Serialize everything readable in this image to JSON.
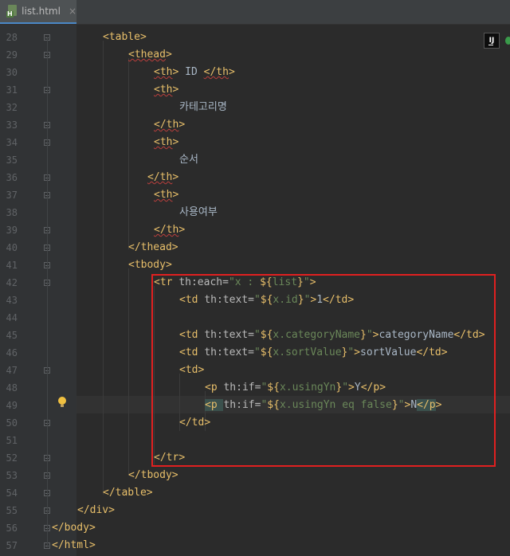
{
  "tabs": [
    {
      "label": "list.html",
      "close": "×",
      "badge": "H"
    }
  ],
  "ide_badge": "IJ",
  "lines": [
    {
      "num": "28",
      "tokens": [
        [
          "tag",
          "<table"
        ],
        [
          "tag",
          ">"
        ]
      ]
    },
    {
      "num": "29",
      "tokens": [
        [
          "tag",
          "<thead"
        ],
        [
          "tag",
          ">"
        ]
      ]
    },
    {
      "num": "30",
      "tokens": [
        [
          "tag",
          "<th"
        ],
        [
          "tag",
          ">"
        ],
        [
          "text",
          " ID "
        ],
        [
          "tag",
          "</th"
        ],
        [
          "tag",
          ">"
        ]
      ]
    },
    {
      "num": "31",
      "tokens": [
        [
          "tag",
          "<th"
        ],
        [
          "tag",
          ">"
        ]
      ]
    },
    {
      "num": "32",
      "tokens": [
        [
          "kr",
          "카테고리명"
        ]
      ]
    },
    {
      "num": "33",
      "tokens": [
        [
          "tag",
          "</th"
        ],
        [
          "tag",
          ">"
        ]
      ]
    },
    {
      "num": "34",
      "tokens": [
        [
          "tag",
          "<th"
        ],
        [
          "tag",
          ">"
        ]
      ]
    },
    {
      "num": "35",
      "tokens": [
        [
          "kr",
          "순서"
        ]
      ]
    },
    {
      "num": "36",
      "tokens": [
        [
          "tag",
          "</th"
        ],
        [
          "tag",
          ">"
        ]
      ]
    },
    {
      "num": "37",
      "tokens": [
        [
          "tag",
          "<th"
        ],
        [
          "tag",
          ">"
        ]
      ]
    },
    {
      "num": "38",
      "tokens": [
        [
          "kr",
          "사용여부"
        ]
      ]
    },
    {
      "num": "39",
      "tokens": [
        [
          "tag",
          "</th"
        ],
        [
          "tag",
          ">"
        ]
      ]
    },
    {
      "num": "40",
      "tokens": [
        [
          "tag",
          "</thead"
        ],
        [
          "tag",
          ">"
        ]
      ]
    },
    {
      "num": "41",
      "tokens": [
        [
          "tag",
          "<tbody"
        ],
        [
          "tag",
          ">"
        ]
      ]
    },
    {
      "num": "42",
      "tokens": [
        [
          "tag",
          "<tr "
        ],
        [
          "attr",
          "th:each="
        ],
        [
          "str",
          "\"x : "
        ],
        [
          "dollar",
          "${"
        ],
        [
          "str",
          "list"
        ],
        [
          "dollar",
          "}"
        ],
        [
          "str",
          "\""
        ],
        [
          "tag",
          ">"
        ]
      ]
    },
    {
      "num": "43",
      "tokens": [
        [
          "tag",
          "<td "
        ],
        [
          "attr",
          "th:text="
        ],
        [
          "str",
          "\""
        ],
        [
          "dollar",
          "${"
        ],
        [
          "str",
          "x.id"
        ],
        [
          "dollar",
          "}"
        ],
        [
          "str",
          "\""
        ],
        [
          "tag",
          ">"
        ],
        [
          "text",
          "1"
        ],
        [
          "tag",
          "</td"
        ],
        [
          "tag",
          ">"
        ]
      ]
    },
    {
      "num": "44",
      "tokens": []
    },
    {
      "num": "45",
      "tokens": [
        [
          "tag",
          "<td "
        ],
        [
          "attr",
          "th:text="
        ],
        [
          "str",
          "\""
        ],
        [
          "dollar",
          "${"
        ],
        [
          "str",
          "x.categoryName"
        ],
        [
          "dollar",
          "}"
        ],
        [
          "str",
          "\""
        ],
        [
          "tag",
          ">"
        ],
        [
          "text",
          "categoryName"
        ],
        [
          "tag",
          "</td"
        ],
        [
          "tag",
          ">"
        ]
      ]
    },
    {
      "num": "46",
      "tokens": [
        [
          "tag",
          "<td "
        ],
        [
          "attr",
          "th:text="
        ],
        [
          "str",
          "\""
        ],
        [
          "dollar",
          "${"
        ],
        [
          "str",
          "x.sortValue"
        ],
        [
          "dollar",
          "}"
        ],
        [
          "str",
          "\""
        ],
        [
          "tag",
          ">"
        ],
        [
          "text",
          "sortValue"
        ],
        [
          "tag",
          "</td"
        ],
        [
          "tag",
          ">"
        ]
      ]
    },
    {
      "num": "47",
      "tokens": [
        [
          "tag",
          "<td"
        ],
        [
          "tag",
          ">"
        ]
      ]
    },
    {
      "num": "48",
      "tokens": [
        [
          "tag",
          "<p "
        ],
        [
          "attr",
          "th:if="
        ],
        [
          "str",
          "\""
        ],
        [
          "dollar",
          "${"
        ],
        [
          "str",
          "x.usingYn"
        ],
        [
          "dollar",
          "}"
        ],
        [
          "str",
          "\""
        ],
        [
          "tag",
          ">"
        ],
        [
          "text",
          "Y"
        ],
        [
          "tag",
          "</p"
        ],
        [
          "tag",
          ">"
        ]
      ]
    },
    {
      "num": "49",
      "tokens": [
        [
          "tag",
          "<p "
        ],
        [
          "attr",
          "th:if="
        ],
        [
          "str",
          "\""
        ],
        [
          "dollar",
          "${"
        ],
        [
          "str",
          "x.usingYn eq false"
        ],
        [
          "dollar",
          "}"
        ],
        [
          "str",
          "\""
        ],
        [
          "tag",
          ">"
        ],
        [
          "text",
          "N"
        ],
        [
          "tag",
          "</p"
        ],
        [
          "tag",
          ">"
        ]
      ]
    },
    {
      "num": "50",
      "tokens": [
        [
          "tag",
          "</td"
        ],
        [
          "tag",
          ">"
        ]
      ]
    },
    {
      "num": "51",
      "tokens": []
    },
    {
      "num": "52",
      "tokens": [
        [
          "tag",
          "</tr"
        ],
        [
          "tag",
          ">"
        ]
      ]
    },
    {
      "num": "53",
      "tokens": [
        [
          "tag",
          "</tbody"
        ],
        [
          "tag",
          ">"
        ]
      ]
    },
    {
      "num": "54",
      "tokens": [
        [
          "tag",
          "</table"
        ],
        [
          "tag",
          ">"
        ]
      ]
    },
    {
      "num": "55",
      "tokens": [
        [
          "tag",
          "</div"
        ],
        [
          "tag",
          ">"
        ]
      ]
    },
    {
      "num": "56",
      "tokens": [
        [
          "tag",
          "</body"
        ],
        [
          "tag",
          ">"
        ]
      ]
    },
    {
      "num": "57",
      "tokens": [
        [
          "tag",
          "</html"
        ],
        [
          "tag",
          ">"
        ]
      ]
    }
  ],
  "colors": {
    "background": "#2b2b2b",
    "gutter": "#313335",
    "tag": "#e8bf6a",
    "attribute": "#bababa",
    "string": "#6a8759",
    "text": "#a9b7c6",
    "highlight_box": "#e02020"
  }
}
